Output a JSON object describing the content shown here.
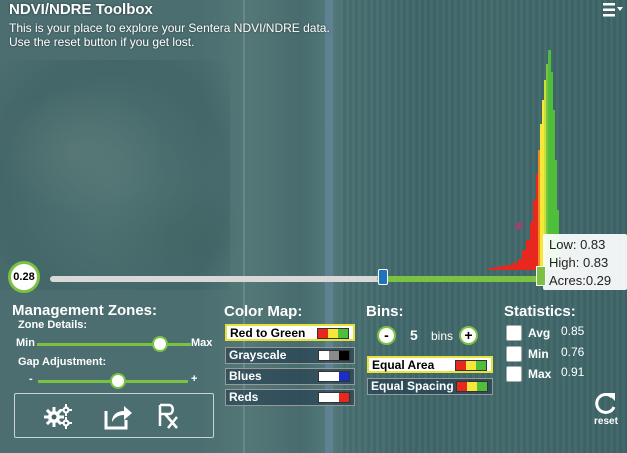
{
  "header": {
    "title": "NDVI/NDRE Toolbox",
    "subtitle": "This is your place to explore your Sentera NDVI/NDRE data. Use the reset button if you get lost."
  },
  "slider": {
    "value_label": "0.28",
    "selected_fraction": 0.34
  },
  "tooltip": {
    "low": "Low: 0.83",
    "high": "High: 0.83",
    "acres": "Acres:0.29"
  },
  "management_zones": {
    "heading": "Management Zones:",
    "zone_details_label": "Zone Details:",
    "min_label": "Min",
    "max_label": "Max",
    "zone_details_fraction": 0.8,
    "gap_label": "Gap Adjustment:",
    "minus_label": "-",
    "plus_label": "+",
    "gap_fraction": 0.53,
    "tools": [
      {
        "name": "settings-gears-icon"
      },
      {
        "name": "share-export-icon"
      },
      {
        "name": "prescription-rx-icon"
      }
    ]
  },
  "color_map": {
    "heading": "Color Map:",
    "options": [
      {
        "label": "Red to Green",
        "selected": true,
        "colors": [
          "#e8271f",
          "#f5e83a",
          "#4fbf3b"
        ]
      },
      {
        "label": "Grayscale",
        "selected": false,
        "colors": [
          "#ffffff",
          "#8a8a8a",
          "#000000"
        ]
      },
      {
        "label": "Blues",
        "selected": false,
        "colors": [
          "#ffffff",
          "#ffffff",
          "#1b2ec8"
        ]
      },
      {
        "label": "Reds",
        "selected": false,
        "colors": [
          "#ffffff",
          "#ffffff",
          "#e8271f"
        ]
      }
    ]
  },
  "bins": {
    "heading": "Bins:",
    "minus": "-",
    "plus": "+",
    "count": "5",
    "unit": "bins",
    "options": [
      {
        "label": "Equal Area",
        "selected": true,
        "colors": [
          "#e8271f",
          "#f5e83a",
          "#4fbf3b"
        ]
      },
      {
        "label": "Equal Spacing",
        "selected": false,
        "colors": [
          "#e8271f",
          "#f5e83a",
          "#4fbf3b"
        ]
      }
    ]
  },
  "statistics": {
    "heading": "Statistics:",
    "items": [
      {
        "label": "Avg",
        "value": "0.85"
      },
      {
        "label": "Min",
        "value": "0.76"
      },
      {
        "label": "Max",
        "value": "0.91"
      }
    ]
  },
  "reset": {
    "label": "reset"
  },
  "colors": {
    "accent_green": "#7cc242",
    "handle_blue": "#1e73be",
    "selected_border": "#e6e23a"
  }
}
